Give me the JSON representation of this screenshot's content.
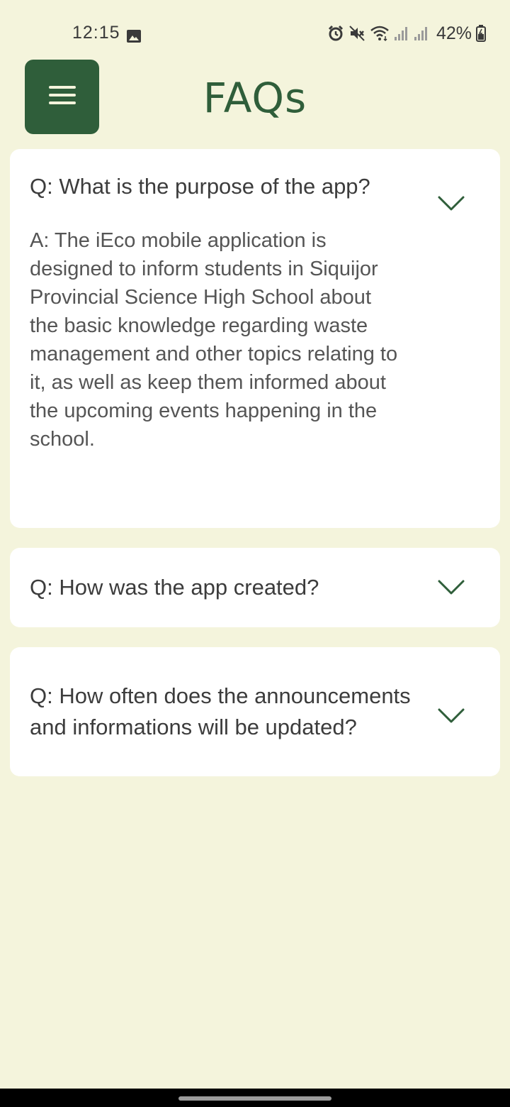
{
  "status_bar": {
    "time": "12:15",
    "battery": "42%",
    "icons": [
      "gallery-icon",
      "alarm-icon",
      "mute-icon",
      "wifi-icon",
      "signal-icon",
      "signal-icon",
      "battery-icon"
    ]
  },
  "header": {
    "title": "FAQs",
    "menu_icon": "hamburger-menu-icon"
  },
  "faqs": [
    {
      "question": "Q: What is the purpose of the app?",
      "answer": "A: The iEco mobile application is designed to inform students in Siquijor Provincial Science High School about the basic knowledge regarding waste management and other topics relating to it, as well as keep them informed about the upcoming events happening in the school.",
      "expanded": true
    },
    {
      "question": "Q: How was the app created?",
      "expanded": false
    },
    {
      "question": "Q: How often does the announcements and informations will be updated?",
      "expanded": false
    }
  ],
  "colors": {
    "background": "#f4f4dc",
    "accent": "#2f5e3a",
    "card": "#ffffff",
    "text": "#3c3c3c"
  }
}
